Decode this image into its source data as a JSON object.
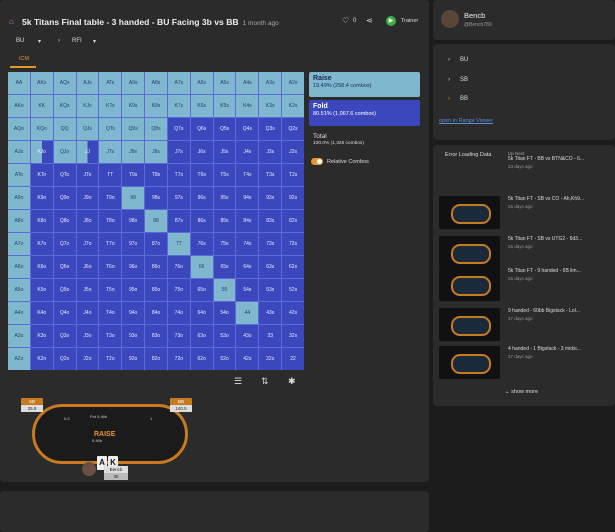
{
  "header": {
    "title": "5k Titans Final table - 3 handed - BU Facing 3b vs BB",
    "ago": "1 month ago",
    "likes": "0",
    "trainer": "Trainer"
  },
  "crumbs": [
    "BU",
    "RFI"
  ],
  "tab": "ICM",
  "grid": [
    [
      "AA",
      "AKs",
      "AQs",
      "AJs",
      "ATs",
      "A9s",
      "A8s",
      "A7s",
      "A6s",
      "A5s",
      "A4s",
      "A3s",
      "A2s"
    ],
    [
      "AKo",
      "KK",
      "KQs",
      "KJs",
      "KTs",
      "K9s",
      "K8s",
      "K7s",
      "K6s",
      "K5s",
      "K4s",
      "K3s",
      "K2s"
    ],
    [
      "AQo",
      "KQo",
      "QQ",
      "QJs",
      "QTs",
      "Q9s",
      "Q8s",
      "Q7s",
      "Q6s",
      "Q5s",
      "Q4s",
      "Q3s",
      "Q2s"
    ],
    [
      "AJo",
      "KJo",
      "QJo",
      "JJ",
      "JTs",
      "J9s",
      "J8s",
      "J7s",
      "J6s",
      "J5s",
      "J4s",
      "J3s",
      "J2s"
    ],
    [
      "ATo",
      "KTo",
      "QTo",
      "JTo",
      "TT",
      "T9s",
      "T8s",
      "T7s",
      "T6s",
      "T5s",
      "T4s",
      "T3s",
      "T2s"
    ],
    [
      "A9o",
      "K9o",
      "Q9o",
      "J9o",
      "T9o",
      "99",
      "98s",
      "97s",
      "96s",
      "95s",
      "94s",
      "93s",
      "92s"
    ],
    [
      "A8o",
      "K8o",
      "Q8o",
      "J8o",
      "T8o",
      "98o",
      "88",
      "87s",
      "86s",
      "85s",
      "84s",
      "83s",
      "82s"
    ],
    [
      "A7o",
      "K7o",
      "Q7o",
      "J7o",
      "T7o",
      "97o",
      "87o",
      "77",
      "76s",
      "75s",
      "74s",
      "73s",
      "72s"
    ],
    [
      "A6o",
      "K6o",
      "Q6o",
      "J6o",
      "T6o",
      "96o",
      "86o",
      "76o",
      "66",
      "65s",
      "64s",
      "63s",
      "62s"
    ],
    [
      "A5o",
      "K5o",
      "Q5o",
      "J5o",
      "T5o",
      "95o",
      "85o",
      "75o",
      "65o",
      "55",
      "54s",
      "53s",
      "52s"
    ],
    [
      "A4o",
      "K4o",
      "Q4o",
      "J4o",
      "T4o",
      "94o",
      "84o",
      "74o",
      "64o",
      "54o",
      "44",
      "43s",
      "42s"
    ],
    [
      "A3o",
      "K3o",
      "Q3o",
      "J3o",
      "T3o",
      "93o",
      "83o",
      "73o",
      "63o",
      "53o",
      "43o",
      "33",
      "32s"
    ],
    [
      "A2o",
      "K2o",
      "Q2o",
      "J2o",
      "T2o",
      "92o",
      "82o",
      "72o",
      "62o",
      "52o",
      "42o",
      "32o",
      "22"
    ]
  ],
  "gridColors": [
    "rrrrrrrrrrrrr",
    "rrrrrrrrrrrrr",
    "rrrrrrrffffff",
    "rmrmrrrffffff",
    "rffffffffffff",
    "rffffrfffffff",
    "rfffffrffffff",
    "rffffffrfffff",
    "rfffffffrffff",
    "rffffffffrfff",
    "rfffffffffrff",
    "rffffffffffff",
    "rffffffffffff"
  ],
  "stats": {
    "raise_label": "Raise",
    "raise_val": "19.49% (258.4 combos)",
    "fold_label": "Fold",
    "fold_val": "80.51% (1,067.6 combos)",
    "total_label": "Total",
    "total_val": "100.0% (1,326 combos)",
    "relative": "Relative Combos"
  },
  "table": {
    "brand": "RAISE",
    "pot": "Pot 5.46b",
    "sb_name": "SB",
    "sb_stack": "25.9",
    "bb_name": "BB",
    "bb_stack": "140.5",
    "hero_name": "Bencb",
    "hero_stack": "35",
    "hero_cards": [
      "A",
      "K"
    ],
    "center": "0.46b",
    "sb_bet": "0.5",
    "bb_bet": "1"
  },
  "user": {
    "name": "Bencb",
    "handle": "@Bencb789"
  },
  "nav": {
    "items": [
      "BU",
      "SB",
      "BB"
    ],
    "open": "open in Range Viewer"
  },
  "related": {
    "error": "Error Loading Data",
    "upnext": "Up Next",
    "show_more": "show more",
    "items": [
      {
        "title": "5k Titan FT - BB vs BTN&CO - 6...",
        "date": "23 days ago"
      },
      {
        "title": "5k Titan FT - SB vs CO - Ah,Kh9...",
        "date": "26 days ago"
      },
      {
        "title": "5k Titan FT - SB vs UTG2 - 6d3...",
        "date": "26 days ago"
      },
      {
        "title": "5k Titan FT - 9 handed - 6B lim...",
        "date": "26 days ago"
      },
      {
        "title": "9 handed - 60bb Bigstack - Lol...",
        "date": "27 days ago"
      },
      {
        "title": "4 handed - 1 Bigstack - 3 midsi...",
        "date": "27 days ago"
      }
    ]
  }
}
